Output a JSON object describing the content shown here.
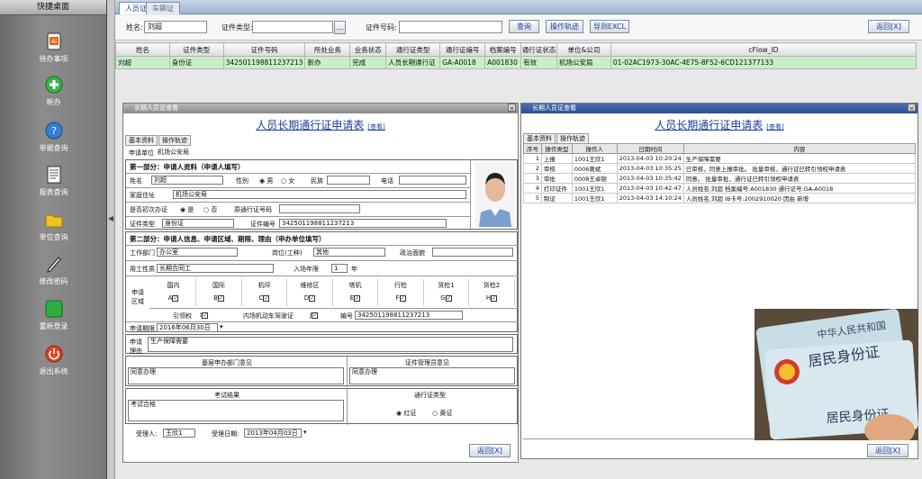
{
  "sidebar": {
    "title": "快捷桌面",
    "items": [
      {
        "label": "待办事项",
        "icon": "document-icon"
      },
      {
        "label": "新办",
        "icon": "plus-icon"
      },
      {
        "label": "单据查询",
        "icon": "help-icon"
      },
      {
        "label": "报表查询",
        "icon": "report-icon"
      },
      {
        "label": "单位查询",
        "icon": "folder-icon"
      },
      {
        "label": "修改密码",
        "icon": "pen-icon"
      },
      {
        "label": "重新登录",
        "icon": "login-icon"
      },
      {
        "label": "退出系统",
        "icon": "power-icon"
      }
    ]
  },
  "tabs": [
    "人员证",
    "车辆证"
  ],
  "search": {
    "name_label": "姓名:",
    "name_value": "刘超",
    "cert_type_label": "证件类型:",
    "cert_no_label": "证件号码:",
    "query": "查询",
    "op_trace": "操作轨迹",
    "export": "导到EXCL",
    "back": "返回[X]"
  },
  "result": {
    "headers": [
      "姓名",
      "证件类型",
      "证件号码",
      "所处业务",
      "业务状态",
      "通行证类型",
      "通行证编号",
      "档案编号",
      "通行证状态",
      "单位&公司",
      "cFlow_ID"
    ],
    "row": [
      "刘超",
      "身份证",
      "342501198811237213",
      "新办",
      "完成",
      "人员长期通行证",
      "GA-A0018",
      "A001830",
      "有效",
      "机场公安局",
      "01-02AC1973-30AC-4E75-8F52-6CD121377133"
    ]
  },
  "left_win": {
    "title": "长期人员证查看",
    "form_title": "人员长期通行证申请表",
    "form_sub": "[查看]",
    "tabs": [
      "基本资料",
      "操作轨迹"
    ],
    "unit_label": "申请单位",
    "unit_value": "机场公安局",
    "part1": "第一部分：申请人资料（申请人填写）",
    "name_label": "姓名",
    "name_value": "刘超",
    "gender_label": "性别",
    "male": "男",
    "female": "女",
    "ethnic_label": "民族",
    "phone_label": "电话",
    "address_label": "家庭住址",
    "address_value": "机场公安局",
    "first_label": "是否初次办证",
    "yes": "是",
    "no": "否",
    "orig_label": "原通行证号码",
    "cert_type_label": "证件类型",
    "cert_type_value": "身份证",
    "cert_no_label": "证件编号",
    "cert_no_value": "342501198811237213",
    "part2": "第二部分：申请人信息、申请区域、期限、理由（申办单位填写）",
    "dept_label": "工作部门",
    "dept_value": "办公室",
    "post_label": "岗位(工种)",
    "post_value": "其他",
    "politic_label": "政治面貌",
    "nature_label": "用工性质",
    "nature_value": "长期合同工",
    "year_label": "入场年限",
    "year_value": "1",
    "year_unit": "年",
    "area_label": "申请区域",
    "areas": [
      "国内",
      "国际",
      "机坪",
      "维修区",
      "塔机",
      "行检",
      "货检1",
      "货检2"
    ],
    "area_codes": [
      "A",
      "B",
      "C",
      "D",
      "E",
      "F",
      "G",
      "H"
    ],
    "guide_label": "引领权",
    "guide_code": "I",
    "car_label": "内场机动车驾驶证",
    "car_code": "J",
    "no_label": "编号",
    "no_value": "342501198811237213",
    "period_label": "申请期限",
    "period_value": "2016年06月30日",
    "reason_label": "申请理由",
    "reason_value": "生产保障需要",
    "opinion_left": "基层申办部门意见",
    "opinion_right": "证件管理员意见",
    "opinion_left_value": "同意办理",
    "opinion_right_value": "同意办理",
    "exam_label": "考试结果",
    "exam_value": "考试合格",
    "pass_type_label": "通行证类型",
    "red": "红证",
    "yellow": "黄证",
    "handler_label": "受理人:",
    "handler_value": "王欣1",
    "date_label": "受理日期:",
    "date_value": "2013年04月03日",
    "back": "返回[X]"
  },
  "right_win": {
    "title": "长期人员证查看",
    "form_title": "人员长期通行证申请表",
    "form_sub": "[查看]",
    "tabs": [
      "基本资料",
      "操作轨迹"
    ],
    "headers": [
      "序号",
      "操作类型",
      "操作人",
      "日期时间",
      "内容"
    ],
    "rows": [
      [
        "1",
        "上报",
        "1001王欣1",
        "2013-04-03 10:20:24",
        "生产保障需要"
      ],
      [
        "2",
        "审核",
        "0006黄斌",
        "2013-04-03 10:35:25",
        "已审核，同意上报审批。 批量审核，通行证已转引领权申请表"
      ],
      [
        "3",
        "审批",
        "0008王卓银",
        "2013-04-03 10:35:42",
        "同意。 批量审批，通行证已转引领权申请表"
      ],
      [
        "4",
        "打印证件",
        "1001王欣1",
        "2013-04-03 10:42:47",
        "人员姓名:刘超 档案编号:A001830 通行证号:GA-A0018"
      ],
      [
        "5",
        "制证",
        "1001王欣1",
        "2013-04-03 14:10:24",
        "人员姓名:刘超 IB卡号:2002910020 因由 新增"
      ]
    ],
    "back": "返回[X]",
    "id_card_lines": [
      "中华人民共和国",
      "居民身份证",
      "居民身份证"
    ]
  },
  "colors": {
    "accent": "#1a3c9e",
    "row_highlight": "#c9efc7",
    "sidebar": "#7a7a7a"
  }
}
